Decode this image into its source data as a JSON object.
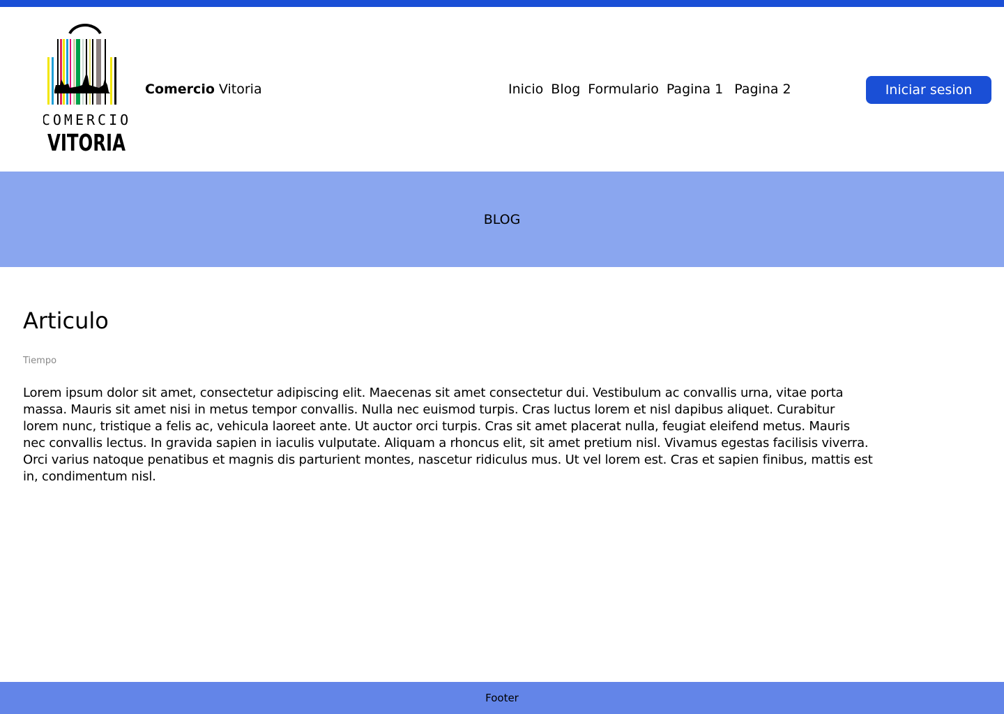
{
  "header": {
    "logo_text": [
      "COMERCIO",
      "VITORIA"
    ],
    "brand_bold": "Comercio",
    "brand_rest": " Vitoria",
    "nav": [
      "Inicio",
      "Blog",
      "Formulario",
      "Pagina 1",
      "Pagina 2"
    ],
    "login_label": "Iniciar sesion"
  },
  "banner": {
    "title": "BLOG"
  },
  "article": {
    "title": "Articulo",
    "time": "Tiempo",
    "body": "Lorem ipsum dolor sit amet, consectetur adipiscing elit. Maecenas sit amet consectetur dui. Vestibulum ac convallis urna, vitae porta massa. Mauris sit amet nisi in metus tempor convallis. Nulla nec euismod turpis. Cras luctus lorem et nisl dapibus aliquet. Curabitur lorem nunc, tristique a felis ac, vehicula laoreet ante. Ut auctor orci turpis. Cras sit amet placerat nulla, feugiat eleifend metus. Mauris nec convallis lectus. In gravida sapien in iaculis vulputate. Aliquam a rhoncus elit, sit amet pretium nisl. Vivamus egestas facilisis viverra. Orci varius natoque penatibus et magnis dis parturient montes, nascetur ridiculus mus. Ut vel lorem est. Cras et sapien finibus, mattis est in, condimentum nisl."
  },
  "footer": {
    "label": "Footer"
  },
  "colors": {
    "primary": "#1a4fd6",
    "banner": "#8aa6ef",
    "footer": "#6385e8"
  }
}
